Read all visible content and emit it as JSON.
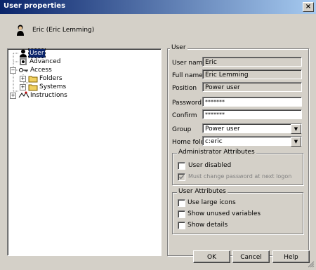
{
  "window": {
    "title": "User properties",
    "close_glyph": "×"
  },
  "header": {
    "user_display": "Eric (Eric Lemming)",
    "icon": "user-icon"
  },
  "tree": {
    "items": [
      {
        "label": "User",
        "icon": "user-icon",
        "selected": true
      },
      {
        "label": "Advanced",
        "icon": "advanced-icon"
      },
      {
        "label": "Access",
        "icon": "key-icon",
        "expander": "−"
      },
      {
        "label": "Folders",
        "icon": "folder-icon",
        "expander": "+"
      },
      {
        "label": "Systems",
        "icon": "folder-icon",
        "expander": "+"
      },
      {
        "label": "Instructions",
        "icon": "instructions-icon",
        "expander": "+"
      }
    ]
  },
  "user_group": {
    "title": "User",
    "fields": {
      "user_name": {
        "label": "User name",
        "value": "Eric"
      },
      "full_name": {
        "label": "Full name",
        "value": "Eric Lemming"
      },
      "position": {
        "label": "Position",
        "value": "Power user"
      },
      "password": {
        "label": "Password",
        "value": "*******"
      },
      "confirm": {
        "label": "Confirm",
        "value": "*******"
      },
      "group": {
        "label": "Group",
        "value": "Power user"
      },
      "home_folder": {
        "label": "Home folder",
        "value": "c:eric"
      }
    }
  },
  "admin_attributes": {
    "title": "Administrator Attributes",
    "user_disabled": {
      "label": "User disabled",
      "checked": false
    },
    "must_change": {
      "label": "Must change password at next logon",
      "checked": true,
      "disabled": true
    }
  },
  "user_attributes": {
    "title": "User Attributes",
    "items": [
      {
        "label": "Use large icons",
        "checked": false
      },
      {
        "label": "Show unused variables",
        "checked": false
      },
      {
        "label": "Show details",
        "checked": false
      }
    ]
  },
  "buttons": {
    "ok": "OK",
    "cancel": "Cancel",
    "help": "Help"
  },
  "colors": {
    "titlebar_start": "#0a246a",
    "titlebar_end": "#a6caf0",
    "face": "#d4d0c8",
    "selection": "#0a246a"
  }
}
